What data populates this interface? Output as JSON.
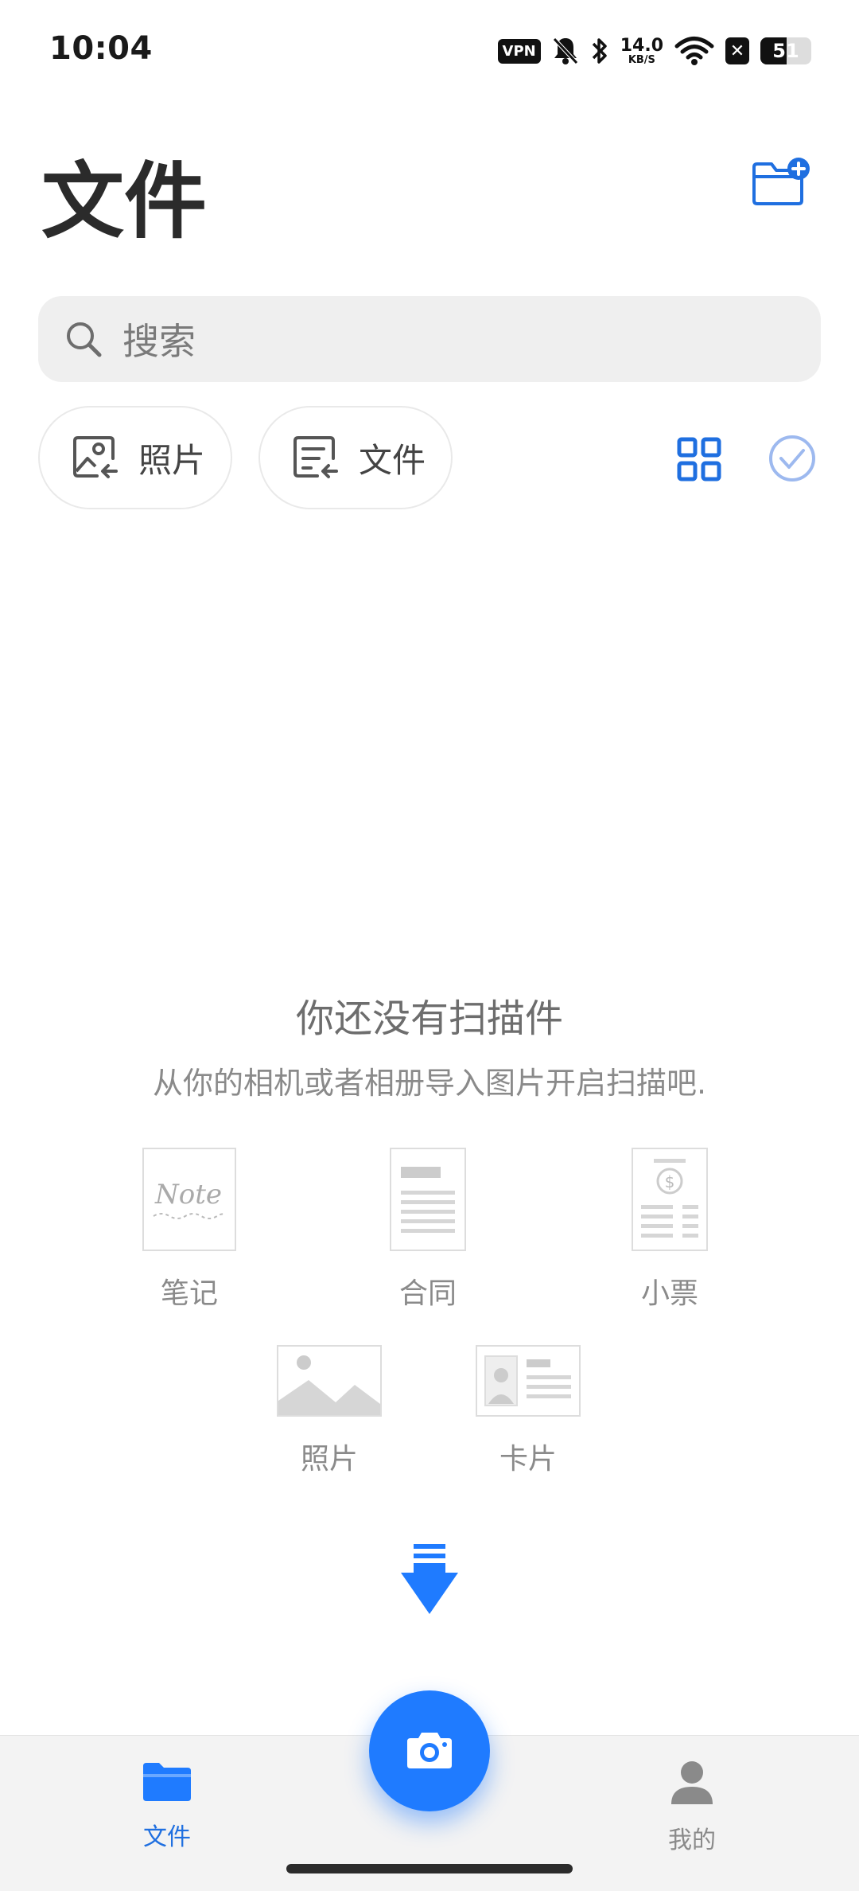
{
  "status_bar": {
    "time": "10:04",
    "vpn": "VPN",
    "network_speed_value": "14.0",
    "network_speed_unit": "KB/S",
    "battery_level": "51",
    "icons": [
      "vpn-icon",
      "bell-muted-icon",
      "bluetooth-icon",
      "wifi-icon",
      "x-icon",
      "battery-icon"
    ]
  },
  "header": {
    "title": "文件",
    "new_folder_icon": "folder-add-icon"
  },
  "search": {
    "placeholder": "搜索",
    "icon": "search-icon"
  },
  "filters": {
    "photo_label": "照片",
    "file_label": "文件",
    "view_icon": "grid-view-icon",
    "select_icon": "check-circle-icon"
  },
  "empty_state": {
    "title": "你还没有扫描件",
    "subtitle": "从你的相机或者相册导入图片开启扫描吧.",
    "templates": [
      {
        "label": "笔记",
        "icon": "note-icon"
      },
      {
        "label": "合同",
        "icon": "contract-icon"
      },
      {
        "label": "小票",
        "icon": "receipt-icon"
      },
      {
        "label": "照片",
        "icon": "photo-icon"
      },
      {
        "label": "卡片",
        "icon": "card-icon"
      }
    ],
    "arrow_icon": "down-arrow-icon"
  },
  "bottom_nav": {
    "files_label": "文件",
    "me_label": "我的",
    "camera_icon": "camera-icon"
  },
  "colors": {
    "accent": "#1f7bff",
    "nav_active": "#1f6fe0",
    "text_muted": "#8a8a8a"
  }
}
